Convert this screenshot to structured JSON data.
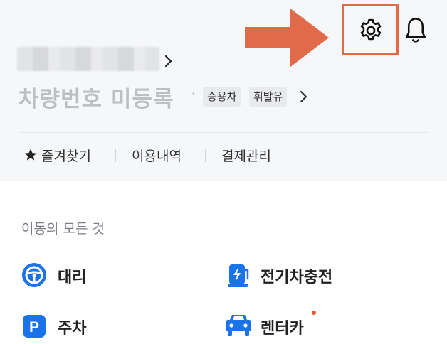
{
  "header": {
    "plate_status": "차량번호 미등록",
    "separator": "·",
    "tags": [
      "승용차",
      "휘발유"
    ]
  },
  "quick_menu": {
    "favorites": "즐겨찾기",
    "history": "이용내역",
    "payment": "결제관리"
  },
  "section": {
    "title": "이동의 모든 것"
  },
  "services": [
    {
      "label": "대리",
      "icon": "steering-wheel-icon"
    },
    {
      "label": "전기차충전",
      "icon": "ev-charging-icon"
    },
    {
      "label": "주차",
      "icon": "parking-icon"
    },
    {
      "label": "렌터카",
      "icon": "car-icon",
      "new_badge": true
    }
  ],
  "colors": {
    "accent_blue": "#1a73e8",
    "highlight_arrow": "#e06a4a",
    "badge_dot": "#e8572b"
  }
}
